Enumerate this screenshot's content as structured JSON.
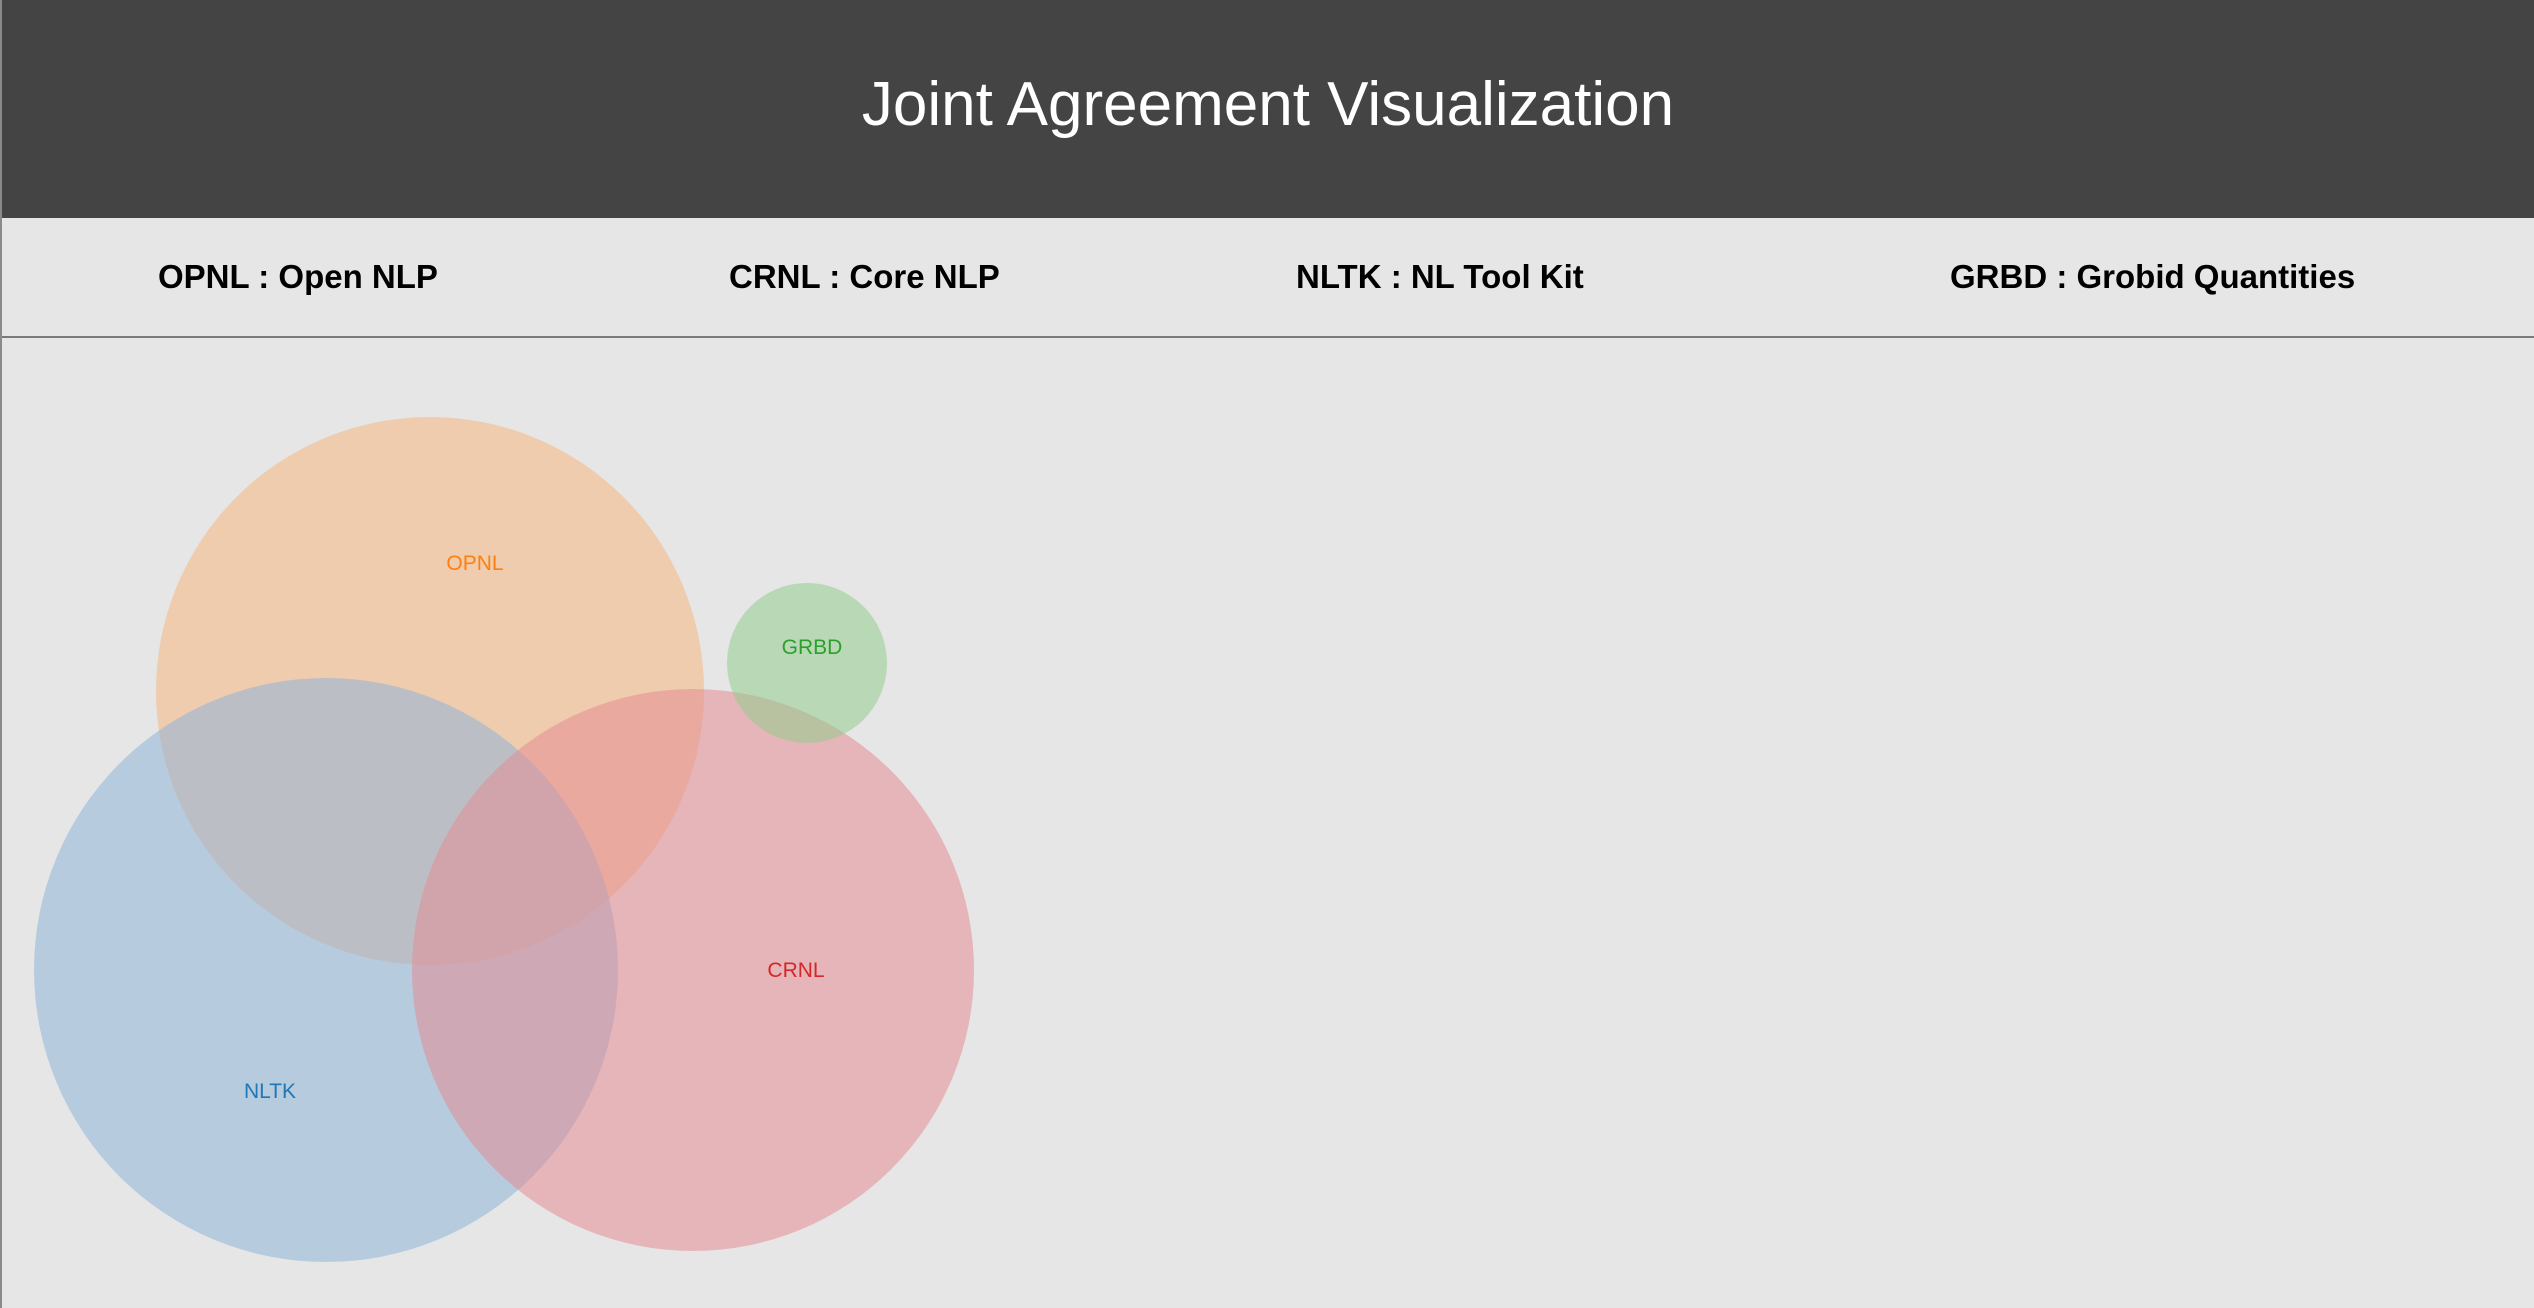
{
  "header": {
    "title": "Joint Agreement Visualization"
  },
  "legend": [
    {
      "code": "OPNL",
      "name": "Open NLP",
      "text": "OPNL : Open NLP"
    },
    {
      "code": "CRNL",
      "name": "Core NLP",
      "text": "CRNL : Core NLP"
    },
    {
      "code": "NLTK",
      "name": "NL Tool Kit",
      "text": "NLTK : NL Tool Kit"
    },
    {
      "code": "GRBD",
      "name": "Grobid Quantities",
      "text": "GRBD : Grobid Quantities"
    }
  ],
  "venn": {
    "sets": [
      {
        "label": "OPNL",
        "fill": "#f5b77d",
        "text_color": "#ff7f0e"
      },
      {
        "label": "NLTK",
        "fill": "#8fb5d9",
        "text_color": "#1f77b4"
      },
      {
        "label": "CRNL",
        "fill": "#e48d93",
        "text_color": "#d62728"
      },
      {
        "label": "GRBD",
        "fill": "#93cc8e",
        "text_color": "#2ca02c"
      }
    ]
  }
}
